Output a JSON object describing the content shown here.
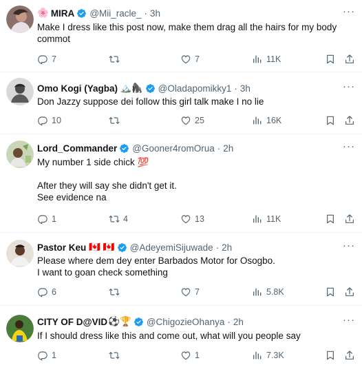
{
  "tweets": [
    {
      "name": "MIRA",
      "name_prefix_emoji": "🌸",
      "name_suffix_emoji": "",
      "handle": "@Mii_racle_",
      "time": "3h",
      "text": "Make I dress like this post now, make them drag all the hairs for my body commot",
      "replies": "7",
      "reposts": "",
      "likes": "7",
      "views": "11K"
    },
    {
      "name": "Omo Kogi (Yagba)",
      "name_prefix_emoji": "",
      "name_suffix_emoji": "🏔️🦍",
      "handle": "@Oladapomikky1",
      "time": "3h",
      "text": "Don Jazzy suppose dei follow this girl talk make I no lie",
      "replies": "10",
      "reposts": "",
      "likes": "25",
      "views": "16K"
    },
    {
      "name": "Lord_Commander",
      "name_prefix_emoji": "",
      "name_suffix_emoji": "",
      "handle": "@Gooner4romOrua",
      "time": "2h",
      "text": "My number 1 side chick 💯\n\nAfter they will say she didn't get it.\nSee evidence na",
      "replies": "1",
      "reposts": "4",
      "likes": "13",
      "views": "11K"
    },
    {
      "name": "Pastor Keu",
      "name_prefix_emoji": "",
      "name_suffix_emoji": "🇨🇦 🇨🇦",
      "handle": "@AdeyemiSijuwade",
      "time": "2h",
      "text": "Please where dem dey enter Barbados Motor for Osogbo.\nI want to goan check something",
      "replies": "6",
      "reposts": "",
      "likes": "7",
      "views": "5.8K"
    },
    {
      "name": "CITY OF D@VID",
      "name_prefix_emoji": "",
      "name_suffix_emoji": "⚽🏆",
      "handle": "@ChigozieOhanya",
      "time": "2h",
      "text": "If I should dress like this and come out, what will you people say",
      "replies": "1",
      "reposts": "",
      "likes": "1",
      "views": "7.3K"
    }
  ],
  "colors": {
    "verified": "#1d9bf0",
    "muted": "#536471",
    "text": "#0f1419",
    "divider": "#eff3f4"
  },
  "icons": {
    "reply": "reply-icon",
    "repost": "repost-icon",
    "like": "like-icon",
    "views": "views-icon",
    "bookmark": "bookmark-icon",
    "share": "share-icon",
    "more": "more-icon",
    "verified": "verified-badge-icon"
  }
}
